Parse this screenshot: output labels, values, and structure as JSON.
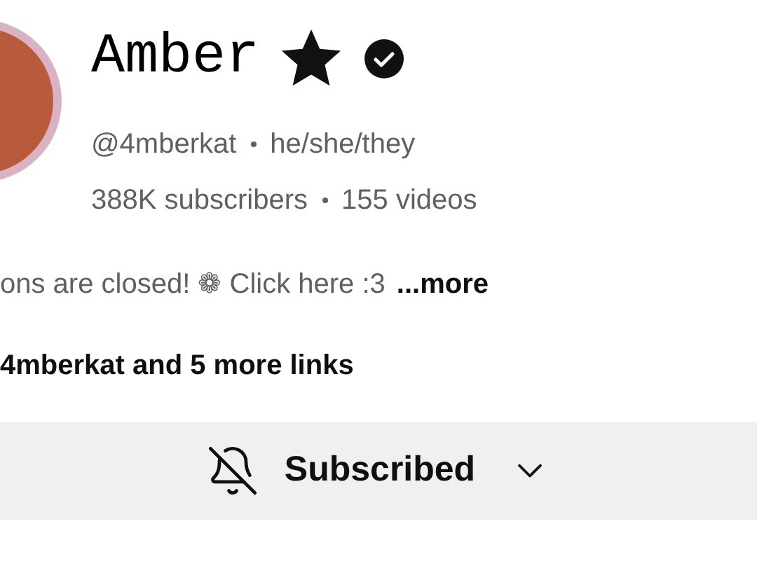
{
  "channel": {
    "name": "Amber",
    "handle": "@4mberkat",
    "pronouns": "he/she/they",
    "subscribers": "388K subscribers",
    "videos": "155 videos"
  },
  "description": {
    "text": "ons are closed! ❁ Click here :3",
    "more": "...more"
  },
  "links": "4mberkat and 5 more links",
  "subscribe_button": {
    "label": "Subscribed"
  }
}
